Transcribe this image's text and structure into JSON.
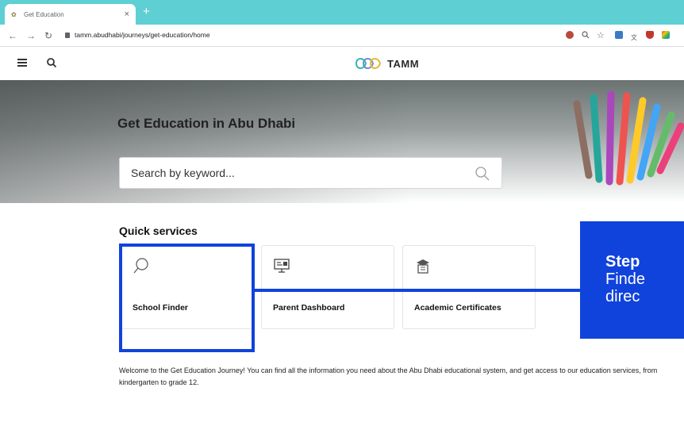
{
  "browser": {
    "tab_title": "Get Education",
    "tab_close": "×",
    "new_tab": "+",
    "url": "tamm.abudhabi/journeys/get-education/home"
  },
  "header": {
    "logo_text": "TAMM"
  },
  "hero": {
    "title": "Get Education in Abu Dhabi",
    "search_placeholder": "Search by keyword..."
  },
  "quick_services": {
    "title": "Quick services",
    "cards": [
      {
        "label": "School Finder",
        "icon": "search-icon"
      },
      {
        "label": "Parent Dashboard",
        "icon": "dashboard-screen-icon"
      },
      {
        "label": "Academic Certificates",
        "icon": "certificate-icon"
      }
    ]
  },
  "callout": {
    "line1": "Step",
    "line2": "Finde",
    "line3": "direc"
  },
  "welcome_text": "Welcome to the Get Education Journey! You can find all the information you need about the Abu Dhabi educational system, and get access to our education services, from kindergarten to grade 12.",
  "colors": {
    "highlight": "#1043dc",
    "tabstrip": "#5ecfd3"
  }
}
